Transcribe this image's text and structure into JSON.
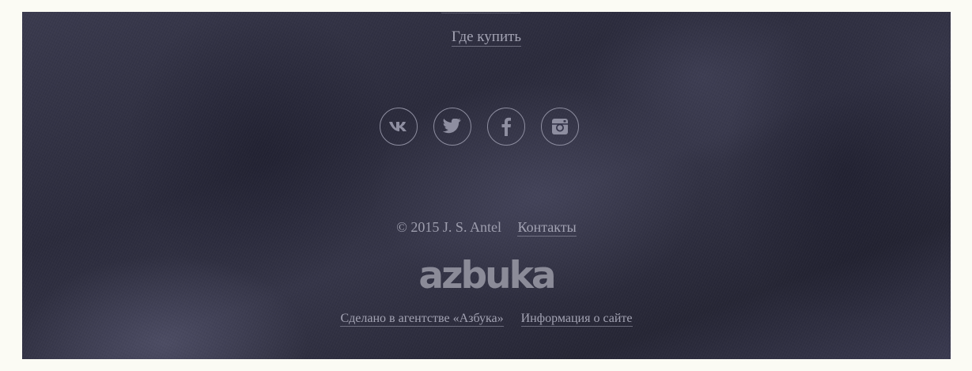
{
  "footer": {
    "where_to_buy": "Где купить",
    "social": [
      {
        "icon": "vk-icon",
        "label": "VK"
      },
      {
        "icon": "twitter-icon",
        "label": "Twitter"
      },
      {
        "icon": "facebook-icon",
        "label": "Facebook"
      },
      {
        "icon": "instagram-icon",
        "label": "Instagram"
      }
    ],
    "copyright": "© 2015 J. S. Antel",
    "contacts_link": "Контакты",
    "logo_text": "azbuka",
    "made_by_link": "Сделано в агентстве «Азбука»",
    "site_info_link": "Информация о сайте"
  },
  "colors": {
    "background": "#2f2f40",
    "text": "#a3a3b3",
    "page": "#fbfbf4"
  }
}
